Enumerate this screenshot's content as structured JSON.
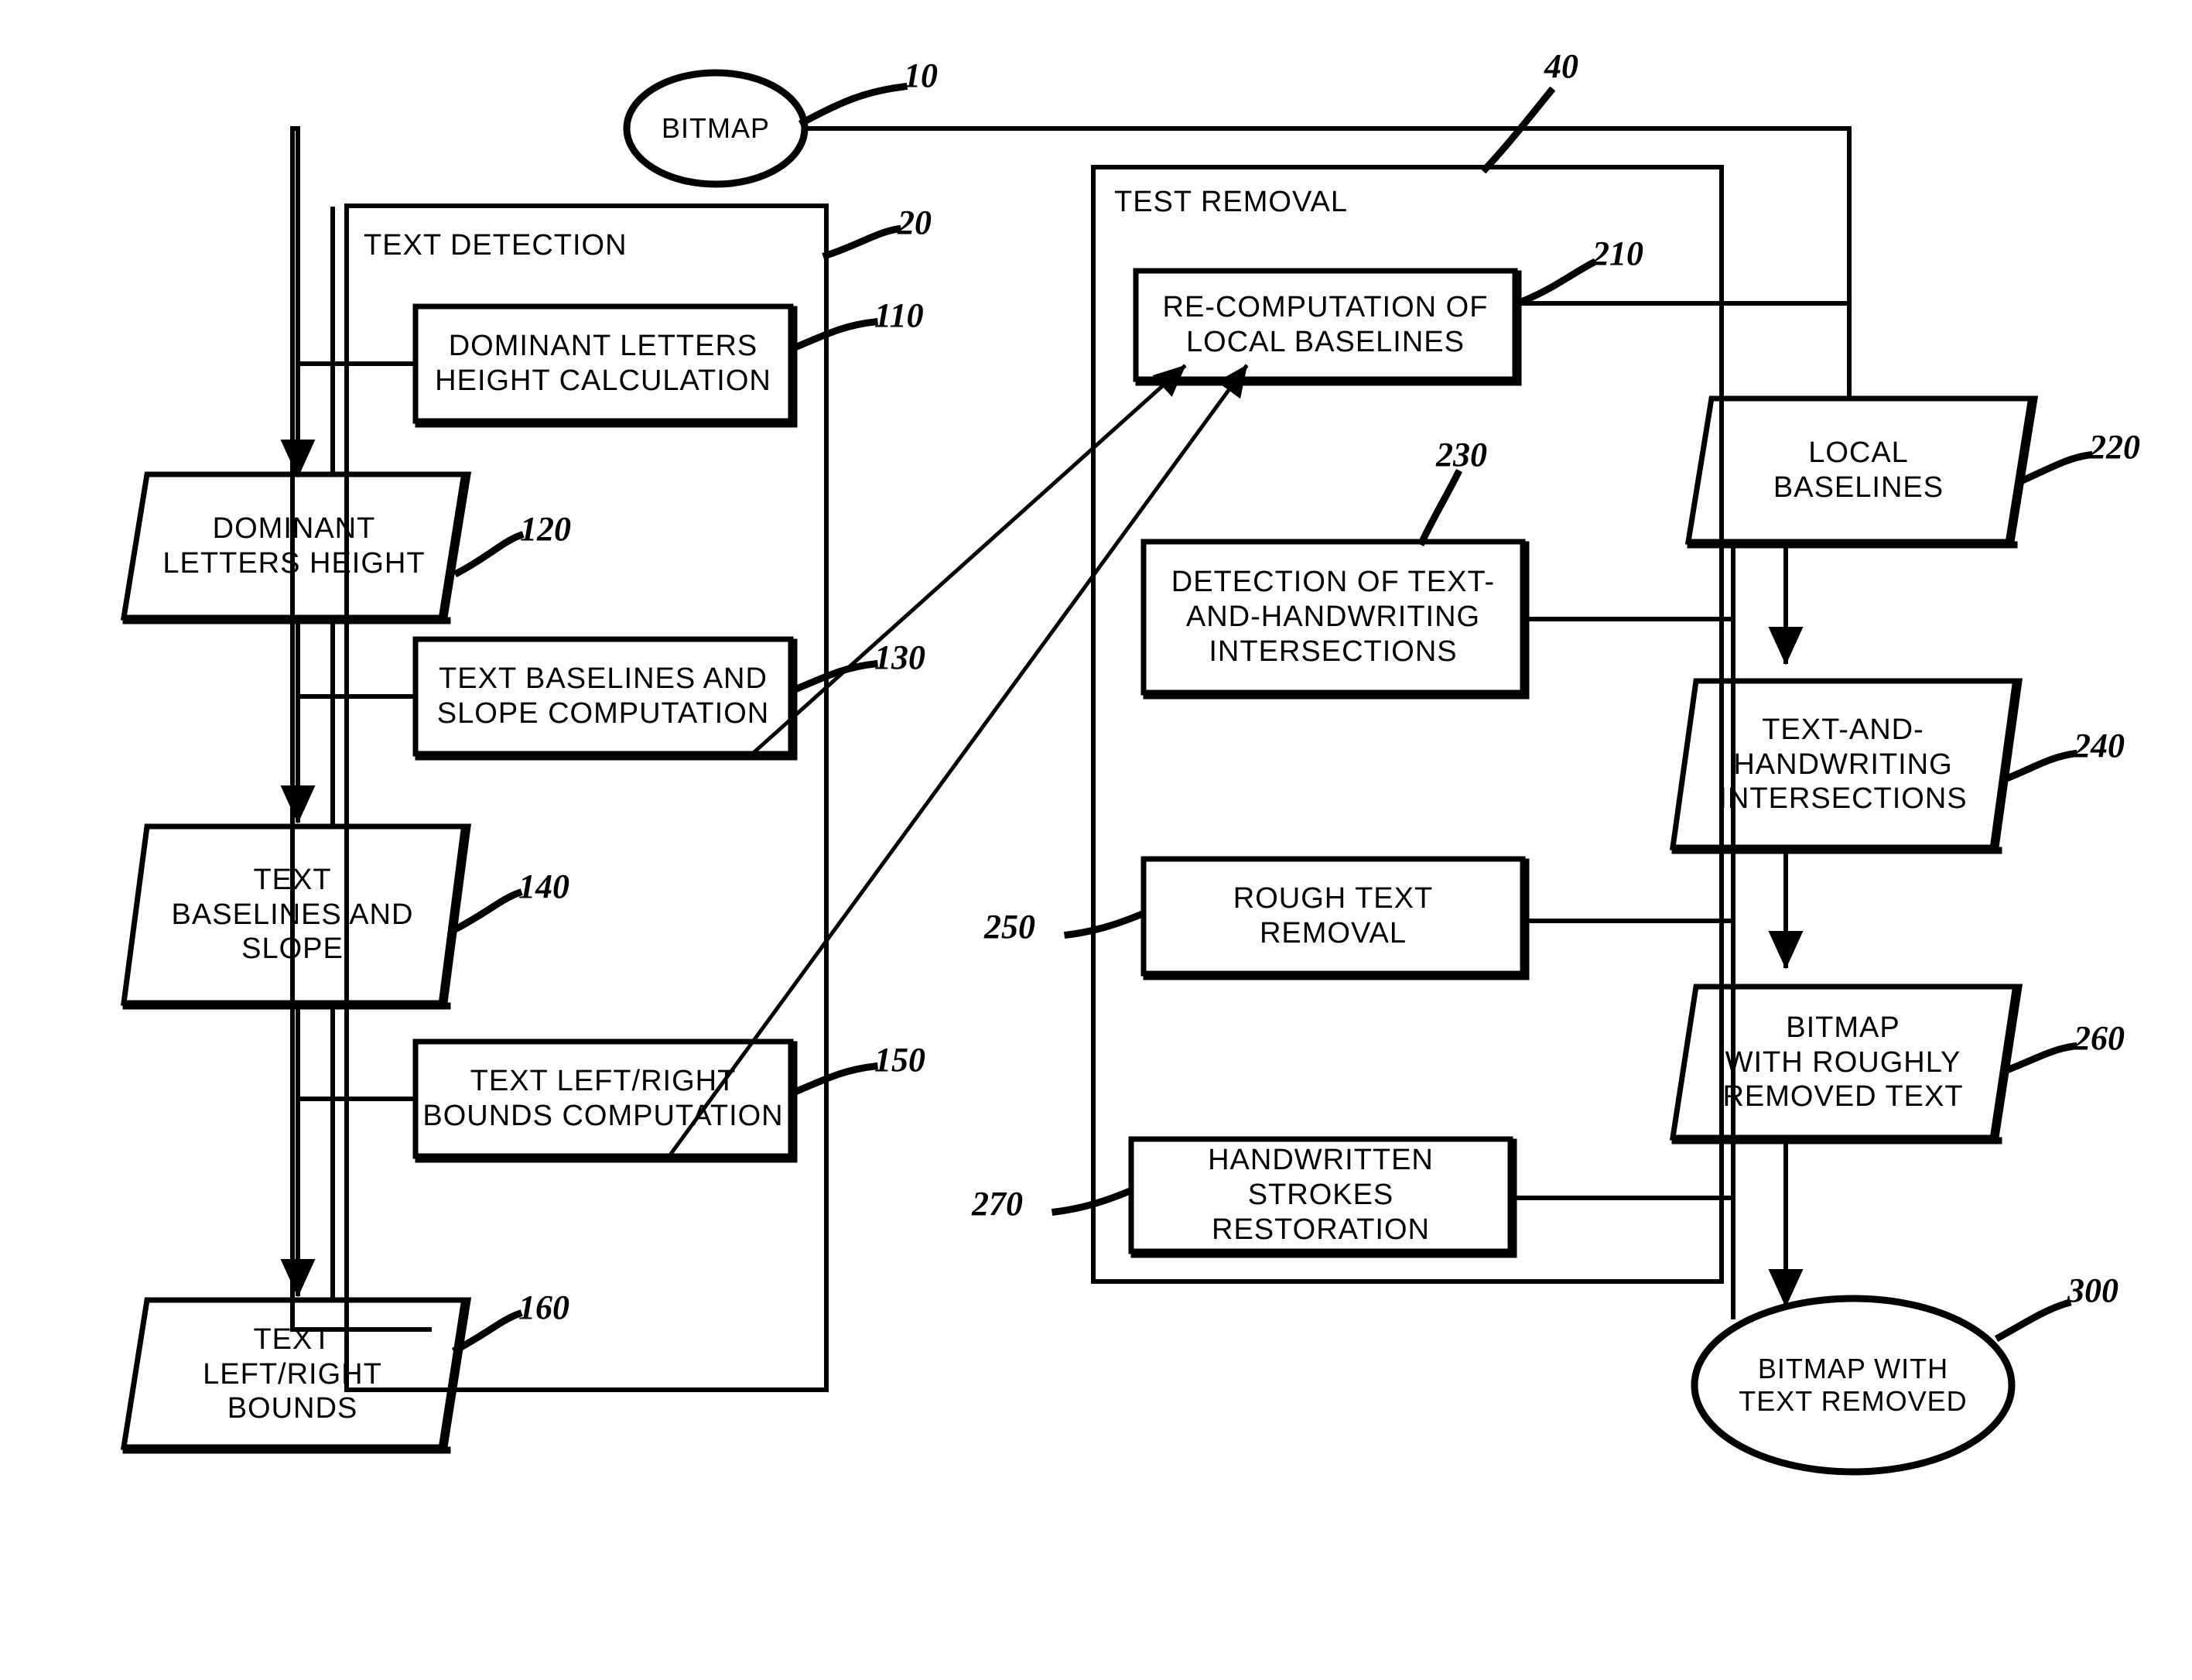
{
  "figure": {
    "type": "patent-flow-diagram",
    "background_color": "#ffffff",
    "stroke_color": "#000000"
  },
  "terminators": [
    {
      "id": "10",
      "label": "BITMAP"
    },
    {
      "id": "300",
      "label": "BITMAP WITH\nTEXT REMOVED"
    }
  ],
  "groups": [
    {
      "id": "20",
      "title": "TEXT DETECTION"
    },
    {
      "id": "40",
      "title": "TEST REMOVAL"
    }
  ],
  "processes": [
    {
      "id": "110",
      "label": "DOMINANT LETTERS\nHEIGHT CALCULATION"
    },
    {
      "id": "130",
      "label": "TEXT BASELINES AND\nSLOPE COMPUTATION"
    },
    {
      "id": "150",
      "label": "TEXT LEFT/RIGHT\nBOUNDS COMPUTATION"
    },
    {
      "id": "210",
      "label": "RE-COMPUTATION OF\nLOCAL BASELINES"
    },
    {
      "id": "230",
      "label": "DETECTION OF TEXT-\nAND-HANDWRITING\nINTERSECTIONS"
    },
    {
      "id": "250",
      "label": "ROUGH TEXT\nREMOVAL"
    },
    {
      "id": "270",
      "label": "HANDWRITTEN STROKES\nRESTORATION"
    }
  ],
  "data_nodes": [
    {
      "id": "120",
      "label": "DOMINANT\nLETTERS HEIGHT"
    },
    {
      "id": "140",
      "label": "TEXT\nBASELINES AND\nSLOPE"
    },
    {
      "id": "160",
      "label": "TEXT\nLEFT/RIGHT\nBOUNDS"
    },
    {
      "id": "220",
      "label": "LOCAL\nBASELINES"
    },
    {
      "id": "240",
      "label": "TEXT-AND-\nHANDWRITING\nINTERSECTIONS"
    },
    {
      "id": "260",
      "label": "BITMAP\nWITH ROUGHLY\nREMOVED TEXT"
    }
  ],
  "reference_numerals": [
    {
      "id": "ref-10",
      "text": "10"
    },
    {
      "id": "ref-20",
      "text": "20"
    },
    {
      "id": "ref-40",
      "text": "40"
    },
    {
      "id": "ref-110",
      "text": "110"
    },
    {
      "id": "ref-120",
      "text": "120"
    },
    {
      "id": "ref-130",
      "text": "130"
    },
    {
      "id": "ref-140",
      "text": "140"
    },
    {
      "id": "ref-150",
      "text": "150"
    },
    {
      "id": "ref-160",
      "text": "160"
    },
    {
      "id": "ref-210",
      "text": "210"
    },
    {
      "id": "ref-220",
      "text": "220"
    },
    {
      "id": "ref-230",
      "text": "230"
    },
    {
      "id": "ref-240",
      "text": "240"
    },
    {
      "id": "ref-250",
      "text": "250"
    },
    {
      "id": "ref-260",
      "text": "260"
    },
    {
      "id": "ref-270",
      "text": "270"
    },
    {
      "id": "ref-300",
      "text": "300"
    }
  ]
}
